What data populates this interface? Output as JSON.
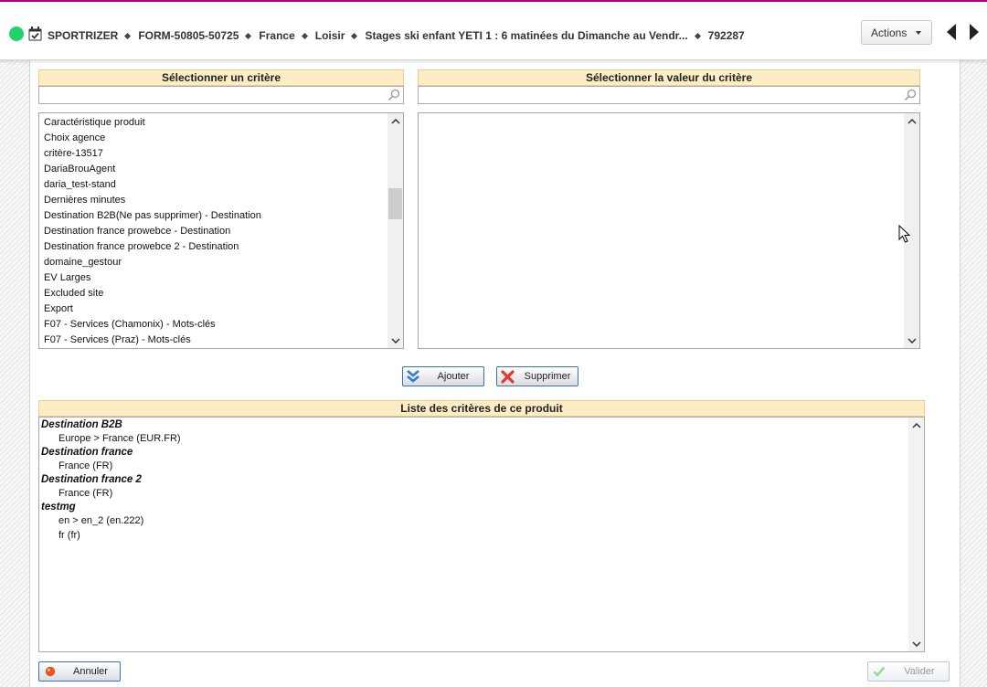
{
  "header": {
    "status": "active",
    "status_color": "#22d36b",
    "breadcrumb": [
      "SPORTRIZER",
      "FORM-50805-50725",
      "France",
      "Loisir",
      "Stages ski enfant YETI 1 : 6 matinées du Dimanche au Vendr...",
      "792287"
    ],
    "actions_label": "Actions"
  },
  "criteria_panel": {
    "title": "Sélectionner un critère",
    "search_value": "",
    "items": [
      "Caractéristique produit",
      "Choix agence",
      "critère-13517",
      "DariaBrouAgent",
      "daria_test-stand",
      "Dernières minutes",
      "Destination B2B(Ne pas supprimer) - Destination",
      "Destination france prowebce - Destination",
      "Destination france prowebce 2 - Destination",
      "domaine_gestour",
      "EV Larges",
      "Excluded site",
      "Export",
      "F07 - Services (Chamonix) - Mots-clés",
      "F07 - Services (Praz) - Mots-clés"
    ]
  },
  "value_panel": {
    "title": "Sélectionner la valeur du critère",
    "search_value": "",
    "items": []
  },
  "buttons": {
    "add": "Ajouter",
    "remove": "Supprimer",
    "cancel": "Annuler",
    "validate": "Valider"
  },
  "product_criteria": {
    "title": "Liste des critères de ce produit",
    "groups": [
      {
        "name": "Destination B2B",
        "values": [
          "Europe > France (EUR.FR)"
        ]
      },
      {
        "name": "Destination france",
        "values": [
          "France (FR)"
        ]
      },
      {
        "name": "Destination france 2",
        "values": [
          "France (FR)"
        ]
      },
      {
        "name": "testmg",
        "values": [
          "en > en_2 (en.222)",
          "fr (fr)"
        ]
      }
    ]
  },
  "colors": {
    "header_bg": "#fdedc5",
    "accent_top": "#b0007a",
    "button_border": "#3d6fa8"
  }
}
